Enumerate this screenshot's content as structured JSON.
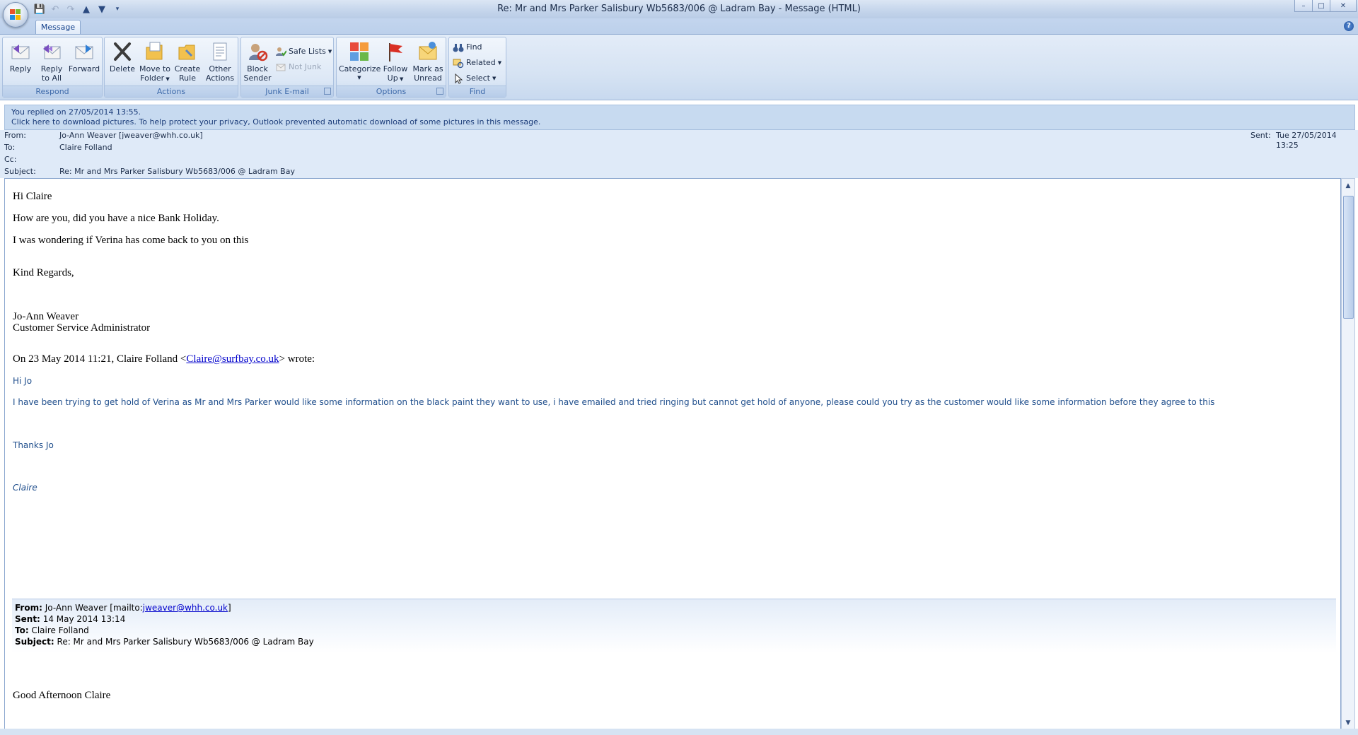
{
  "window": {
    "title": "Re: Mr and Mrs Parker Salisbury Wb5683/006 @ Ladram Bay - Message (HTML)",
    "qat_icons": [
      "save-icon",
      "undo-icon",
      "redo-icon",
      "up-icon",
      "down-icon",
      "customize-icon"
    ]
  },
  "ribbon": {
    "tab_label": "Message",
    "groups": {
      "respond": {
        "label": "Respond",
        "reply": "Reply",
        "reply_all_1": "Reply",
        "reply_all_2": "to All",
        "forward": "Forward"
      },
      "actions": {
        "label": "Actions",
        "delete": "Delete",
        "move_1": "Move to",
        "move_2": "Folder",
        "create_1": "Create",
        "create_2": "Rule",
        "other_1": "Other",
        "other_2": "Actions"
      },
      "junk": {
        "label": "Junk E-mail",
        "block_1": "Block",
        "block_2": "Sender",
        "safe_lists": "Safe Lists",
        "not_junk": "Not Junk"
      },
      "options": {
        "label": "Options",
        "categorize": "Categorize",
        "follow_1": "Follow",
        "follow_2": "Up",
        "mark_1": "Mark as",
        "mark_2": "Unread"
      },
      "find": {
        "label": "Find",
        "find": "Find",
        "related": "Related",
        "select": "Select"
      }
    }
  },
  "infobar": {
    "line1": "You replied on 27/05/2014 13:55.",
    "line2": "Click here to download pictures. To help protect your privacy, Outlook prevented automatic download of some pictures in this message."
  },
  "header": {
    "from_label": "From:",
    "from_value": "Jo-Ann Weaver [jweaver@whh.co.uk]",
    "to_label": "To:",
    "to_value": "Claire Folland",
    "cc_label": "Cc:",
    "cc_value": "",
    "subject_label": "Subject:",
    "subject_value": "Re: Mr and Mrs Parker Salisbury Wb5683/006 @ Ladram Bay",
    "sent_label": "Sent:",
    "sent_value": "Tue 27/05/2014 13:25"
  },
  "body": {
    "greeting": "Hi Claire",
    "line1": "How are you, did you have a nice Bank Holiday.",
    "line2": "I was wondering if Verina has come back to you on this",
    "regards": "Kind Regards,",
    "sig_name": "Jo-Ann Weaver",
    "sig_title": "Customer Service Administrator",
    "quote_intro_pre": "On 23 May 2014 11:21, Claire Folland <",
    "quote_intro_link": "Claire@surfbay.co.uk",
    "quote_intro_post": "> wrote:",
    "q_greeting": "Hi Jo",
    "q_text": "I have been trying to get hold of Verina as Mr and Mrs Parker would like some information on the black paint they want to use, i have emailed and tried ringing but cannot get hold of anyone, please could you try as the customer would like some information before they agree to this",
    "q_thanks": "Thanks Jo",
    "q_sig": "Claire",
    "fwd": {
      "from_label": "From:",
      "from_value": "Jo-Ann Weaver [mailto:",
      "from_link": "jweaver@whh.co.uk",
      "from_close": "]",
      "sent_label": "Sent:",
      "sent_value": "14 May 2014 13:14",
      "to_label": "To:",
      "to_value": "Claire Folland",
      "subject_label": "Subject:",
      "subject_value": "Re: Mr and Mrs Parker Salisbury Wb5683/006 @ Ladram Bay"
    },
    "afternoon": "Good Afternoon Claire"
  }
}
